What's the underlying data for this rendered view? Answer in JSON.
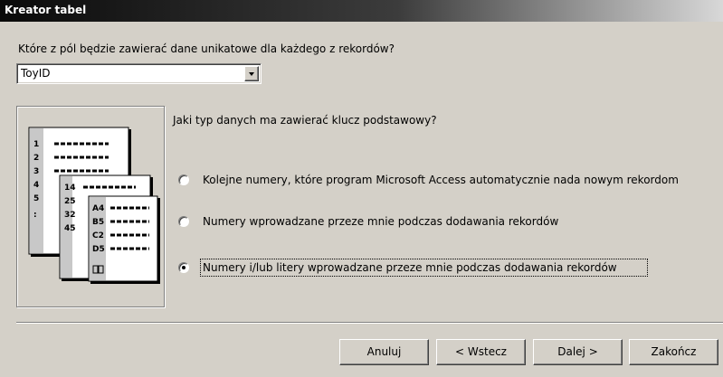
{
  "window": {
    "title": "Kreator tabel"
  },
  "field_question": "Które z pól będzie zawierać dane unikatowe dla każdego z rekordów?",
  "field_combo": {
    "value": "ToyID"
  },
  "illustration": {
    "rows_front": [
      "A4",
      "B5",
      "C2",
      "D5"
    ],
    "rows_middle": [
      "14",
      "25",
      "32",
      "45"
    ],
    "rows_back": [
      "1",
      "2",
      "3",
      "4",
      "5",
      ":"
    ]
  },
  "key_question": "Jaki typ danych ma zawierać klucz podstawowy?",
  "options": [
    {
      "label": "Kolejne numery, które program Microsoft Access automatycznie nada nowym rekordom",
      "checked": false
    },
    {
      "label": "Numery wprowadzane przeze mnie podczas dodawania rekordów",
      "checked": false
    },
    {
      "label": "Numery i/lub litery wprowadzane przeze mnie podczas dodawania rekordów",
      "checked": true
    }
  ],
  "buttons": {
    "cancel": "Anuluj",
    "back": "< Wstecz",
    "next": "Dalej >",
    "finish": "Zakończ"
  }
}
